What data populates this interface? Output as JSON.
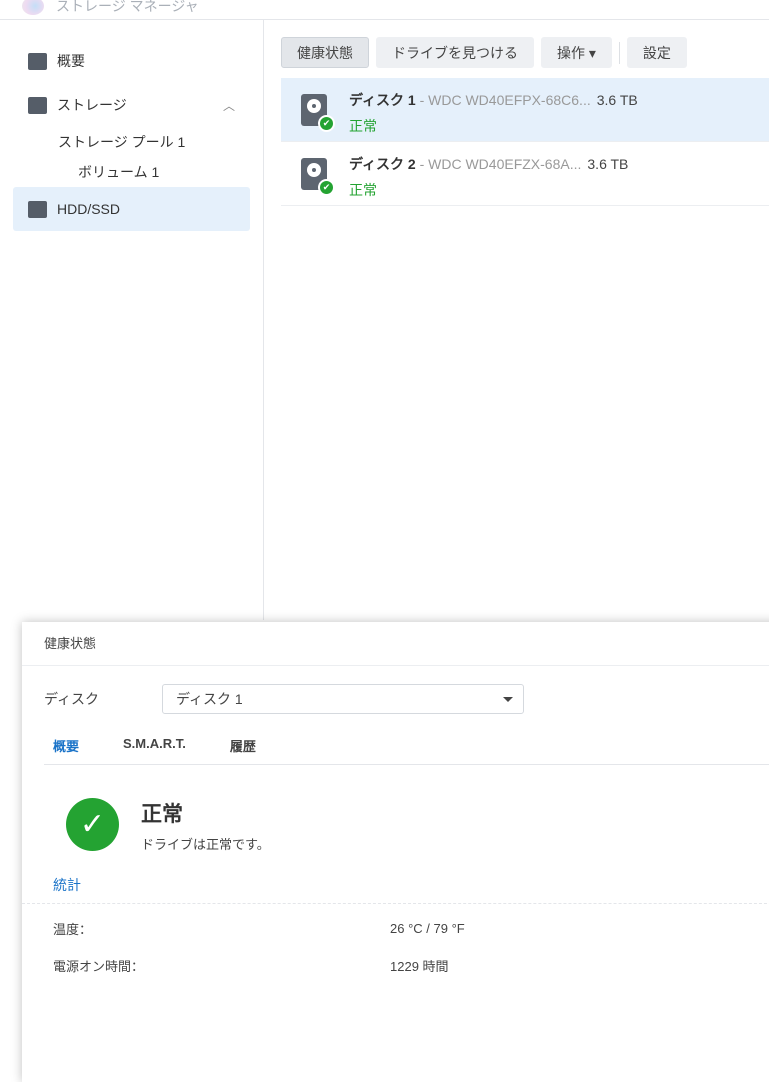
{
  "app": {
    "title": "ストレージ マネージャ"
  },
  "sidebar": {
    "overview": "概要",
    "storage": "ストレージ",
    "pool": "ストレージ プール 1",
    "volume": "ボリューム 1",
    "hdd": "HDD/SSD"
  },
  "toolbar": {
    "health": "健康状態",
    "locate": "ドライブを見つける",
    "action": "操作 ▾",
    "settings": "設定"
  },
  "disks": [
    {
      "name": "ディスク 1",
      "model": " - WDC WD40EFPX-68C6...",
      "size": "3.6 TB",
      "status": "正常"
    },
    {
      "name": "ディスク 2",
      "model": " - WDC WD40EFZX-68A...",
      "size": "3.6 TB",
      "status": "正常"
    }
  ],
  "dialog": {
    "title": "健康状態",
    "disk_label": "ディスク",
    "disk_value": "ディスク 1",
    "tabs": [
      "概要",
      "S.M.A.R.T.",
      "履歴"
    ],
    "status_title": "正常",
    "status_desc": "ドライブは正常です。",
    "section": "統計",
    "stats": [
      {
        "k": "温度：",
        "v": "26 °C / 79 °F"
      },
      {
        "k": "電源オン時間：",
        "v": "1229 時間"
      }
    ]
  },
  "colors": {
    "accent": "#1a73c8",
    "ok": "#24a332",
    "selected": "#e5f0fb"
  }
}
